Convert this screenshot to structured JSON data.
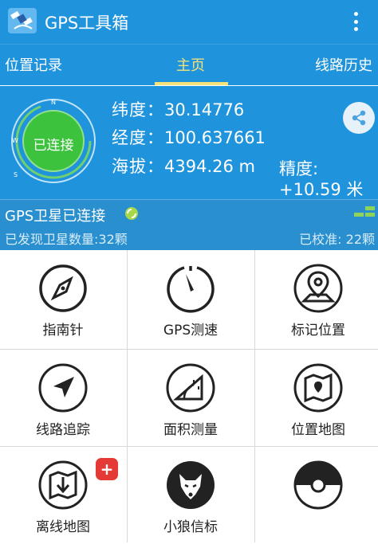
{
  "app": {
    "title": "GPS工具箱",
    "logo_icon": "satellite-app-logo"
  },
  "tabs": [
    {
      "label": "位置记录"
    },
    {
      "label": "主页",
      "active": true
    },
    {
      "label": "线路历史"
    }
  ],
  "status": {
    "connection_label": "已连接",
    "latitude_label": "纬度：",
    "latitude_value": "30.14776",
    "longitude_label": "经度：",
    "longitude_value": "100.637661",
    "altitude_label": "海拔：",
    "altitude_value": "4394.26 m",
    "accuracy_label": "精度:",
    "accuracy_value": "+10.59 米"
  },
  "gps": {
    "title": "GPS卫星已连接",
    "satellites_found": "已发现卫星数量:32颗",
    "calibrated": "已校准: 22颗"
  },
  "tools": [
    {
      "label": "指南针",
      "icon": "compass-icon"
    },
    {
      "label": "GPS测速",
      "icon": "speedometer-icon"
    },
    {
      "label": "标记位置",
      "icon": "map-pin-icon"
    },
    {
      "label": "线路追踪",
      "icon": "navigation-arrow-icon"
    },
    {
      "label": "面积测量",
      "icon": "protractor-icon"
    },
    {
      "label": "位置地图",
      "icon": "map-icon"
    },
    {
      "label": "离线地图",
      "icon": "download-map-icon",
      "badge": "+"
    },
    {
      "label": "小狼信标",
      "icon": "wolf-icon"
    },
    {
      "label": "",
      "icon": "pokeball-icon"
    }
  ],
  "colors": {
    "primary": "#1f93dc",
    "active_tab": "#f6e27a",
    "connected_green": "#3cc23c",
    "badge_red": "#e53935"
  }
}
